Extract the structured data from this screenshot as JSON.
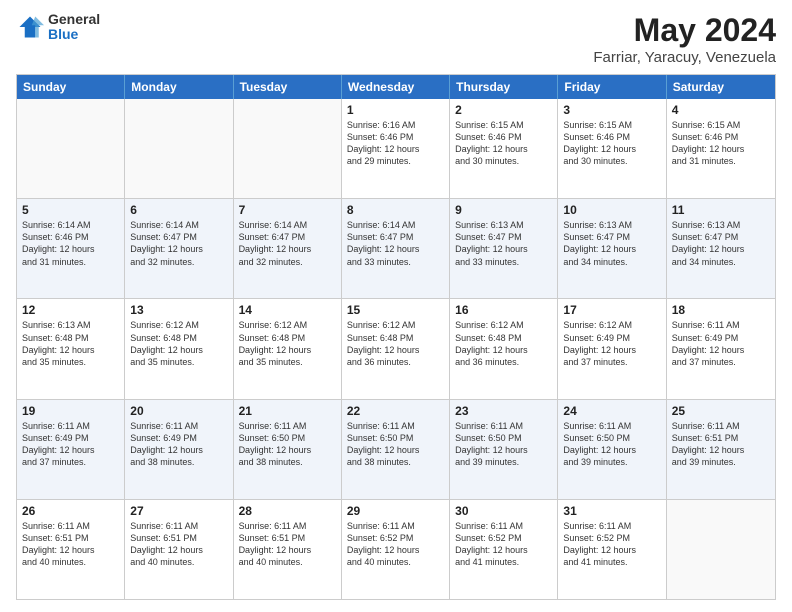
{
  "header": {
    "logo_line1": "General",
    "logo_line2": "Blue",
    "title": "May 2024",
    "subtitle": "Farriar, Yaracuy, Venezuela"
  },
  "calendar": {
    "weekdays": [
      "Sunday",
      "Monday",
      "Tuesday",
      "Wednesday",
      "Thursday",
      "Friday",
      "Saturday"
    ],
    "rows": [
      [
        {
          "day": "",
          "info": ""
        },
        {
          "day": "",
          "info": ""
        },
        {
          "day": "",
          "info": ""
        },
        {
          "day": "1",
          "info": "Sunrise: 6:16 AM\nSunset: 6:46 PM\nDaylight: 12 hours\nand 29 minutes."
        },
        {
          "day": "2",
          "info": "Sunrise: 6:15 AM\nSunset: 6:46 PM\nDaylight: 12 hours\nand 30 minutes."
        },
        {
          "day": "3",
          "info": "Sunrise: 6:15 AM\nSunset: 6:46 PM\nDaylight: 12 hours\nand 30 minutes."
        },
        {
          "day": "4",
          "info": "Sunrise: 6:15 AM\nSunset: 6:46 PM\nDaylight: 12 hours\nand 31 minutes."
        }
      ],
      [
        {
          "day": "5",
          "info": "Sunrise: 6:14 AM\nSunset: 6:46 PM\nDaylight: 12 hours\nand 31 minutes."
        },
        {
          "day": "6",
          "info": "Sunrise: 6:14 AM\nSunset: 6:47 PM\nDaylight: 12 hours\nand 32 minutes."
        },
        {
          "day": "7",
          "info": "Sunrise: 6:14 AM\nSunset: 6:47 PM\nDaylight: 12 hours\nand 32 minutes."
        },
        {
          "day": "8",
          "info": "Sunrise: 6:14 AM\nSunset: 6:47 PM\nDaylight: 12 hours\nand 33 minutes."
        },
        {
          "day": "9",
          "info": "Sunrise: 6:13 AM\nSunset: 6:47 PM\nDaylight: 12 hours\nand 33 minutes."
        },
        {
          "day": "10",
          "info": "Sunrise: 6:13 AM\nSunset: 6:47 PM\nDaylight: 12 hours\nand 34 minutes."
        },
        {
          "day": "11",
          "info": "Sunrise: 6:13 AM\nSunset: 6:47 PM\nDaylight: 12 hours\nand 34 minutes."
        }
      ],
      [
        {
          "day": "12",
          "info": "Sunrise: 6:13 AM\nSunset: 6:48 PM\nDaylight: 12 hours\nand 35 minutes."
        },
        {
          "day": "13",
          "info": "Sunrise: 6:12 AM\nSunset: 6:48 PM\nDaylight: 12 hours\nand 35 minutes."
        },
        {
          "day": "14",
          "info": "Sunrise: 6:12 AM\nSunset: 6:48 PM\nDaylight: 12 hours\nand 35 minutes."
        },
        {
          "day": "15",
          "info": "Sunrise: 6:12 AM\nSunset: 6:48 PM\nDaylight: 12 hours\nand 36 minutes."
        },
        {
          "day": "16",
          "info": "Sunrise: 6:12 AM\nSunset: 6:48 PM\nDaylight: 12 hours\nand 36 minutes."
        },
        {
          "day": "17",
          "info": "Sunrise: 6:12 AM\nSunset: 6:49 PM\nDaylight: 12 hours\nand 37 minutes."
        },
        {
          "day": "18",
          "info": "Sunrise: 6:11 AM\nSunset: 6:49 PM\nDaylight: 12 hours\nand 37 minutes."
        }
      ],
      [
        {
          "day": "19",
          "info": "Sunrise: 6:11 AM\nSunset: 6:49 PM\nDaylight: 12 hours\nand 37 minutes."
        },
        {
          "day": "20",
          "info": "Sunrise: 6:11 AM\nSunset: 6:49 PM\nDaylight: 12 hours\nand 38 minutes."
        },
        {
          "day": "21",
          "info": "Sunrise: 6:11 AM\nSunset: 6:50 PM\nDaylight: 12 hours\nand 38 minutes."
        },
        {
          "day": "22",
          "info": "Sunrise: 6:11 AM\nSunset: 6:50 PM\nDaylight: 12 hours\nand 38 minutes."
        },
        {
          "day": "23",
          "info": "Sunrise: 6:11 AM\nSunset: 6:50 PM\nDaylight: 12 hours\nand 39 minutes."
        },
        {
          "day": "24",
          "info": "Sunrise: 6:11 AM\nSunset: 6:50 PM\nDaylight: 12 hours\nand 39 minutes."
        },
        {
          "day": "25",
          "info": "Sunrise: 6:11 AM\nSunset: 6:51 PM\nDaylight: 12 hours\nand 39 minutes."
        }
      ],
      [
        {
          "day": "26",
          "info": "Sunrise: 6:11 AM\nSunset: 6:51 PM\nDaylight: 12 hours\nand 40 minutes."
        },
        {
          "day": "27",
          "info": "Sunrise: 6:11 AM\nSunset: 6:51 PM\nDaylight: 12 hours\nand 40 minutes."
        },
        {
          "day": "28",
          "info": "Sunrise: 6:11 AM\nSunset: 6:51 PM\nDaylight: 12 hours\nand 40 minutes."
        },
        {
          "day": "29",
          "info": "Sunrise: 6:11 AM\nSunset: 6:52 PM\nDaylight: 12 hours\nand 40 minutes."
        },
        {
          "day": "30",
          "info": "Sunrise: 6:11 AM\nSunset: 6:52 PM\nDaylight: 12 hours\nand 41 minutes."
        },
        {
          "day": "31",
          "info": "Sunrise: 6:11 AM\nSunset: 6:52 PM\nDaylight: 12 hours\nand 41 minutes."
        },
        {
          "day": "",
          "info": ""
        }
      ]
    ]
  }
}
